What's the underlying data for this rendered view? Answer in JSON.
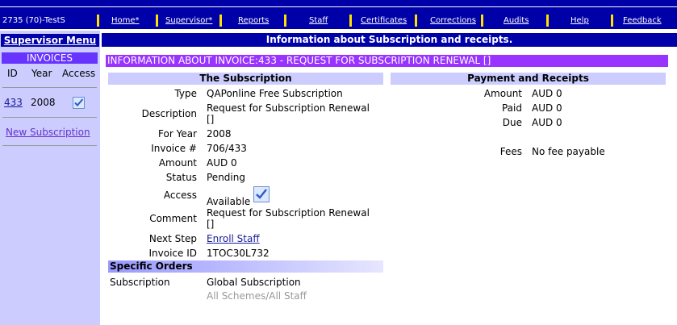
{
  "topbar": {
    "account": "2735 (70)-TestS",
    "nav": [
      "Home*",
      "Supervisor*",
      "Reports",
      "Staff",
      "Certificates",
      "Corrections",
      "Audits",
      "Help",
      "Feedback"
    ]
  },
  "sidebar": {
    "title": "Supervisor Menu",
    "section": "INVOICES",
    "columns": [
      "ID",
      "Year",
      "Access"
    ],
    "invoice": {
      "id": "433",
      "year": "2008",
      "access_icon": "checkbox-checked-icon"
    },
    "new_subscription": "New Subscription"
  },
  "main": {
    "header": "Information about Subscription and receipts.",
    "invoice_bar": "INFORMATION ABOUT INVOICE:433 - REQUEST FOR SUBSCRIPTION RENEWAL []",
    "subscription": {
      "heading": "The Subscription",
      "type_label": "Type",
      "type_value": "QAPonline Free Subscription",
      "desc_label": "Description",
      "desc_line1": "Request for Subscription Renewal",
      "desc_line2": "[]",
      "year_label": "For Year",
      "year_value": "2008",
      "invoice_label": "Invoice #",
      "invoice_value": "706/433",
      "amount_label": "Amount",
      "amount_value": "AUD 0",
      "status_label": "Status",
      "status_value": "Pending",
      "access_label": "Access",
      "access_value": "Available",
      "comment_label": "Comment",
      "comment_line1": "Request for Subscription Renewal",
      "comment_line2": "[]",
      "next_label": "Next Step",
      "next_value": "Enroll Staff",
      "invoiceid_label": "Invoice ID",
      "invoiceid_value": "1TOC30L732"
    },
    "payment": {
      "heading": "Payment and Receipts",
      "amount_label": "Amount",
      "amount_value": "AUD 0",
      "paid_label": "Paid",
      "paid_value": "AUD 0",
      "due_label": "Due",
      "due_value": "AUD 0",
      "fees_label": "Fees",
      "fees_value": "No fee payable"
    },
    "orders": {
      "heading": "Specific Orders",
      "label": "Subscription",
      "value": "Global Subscription",
      "sub_value": "All Schemes/All Staff"
    }
  }
}
